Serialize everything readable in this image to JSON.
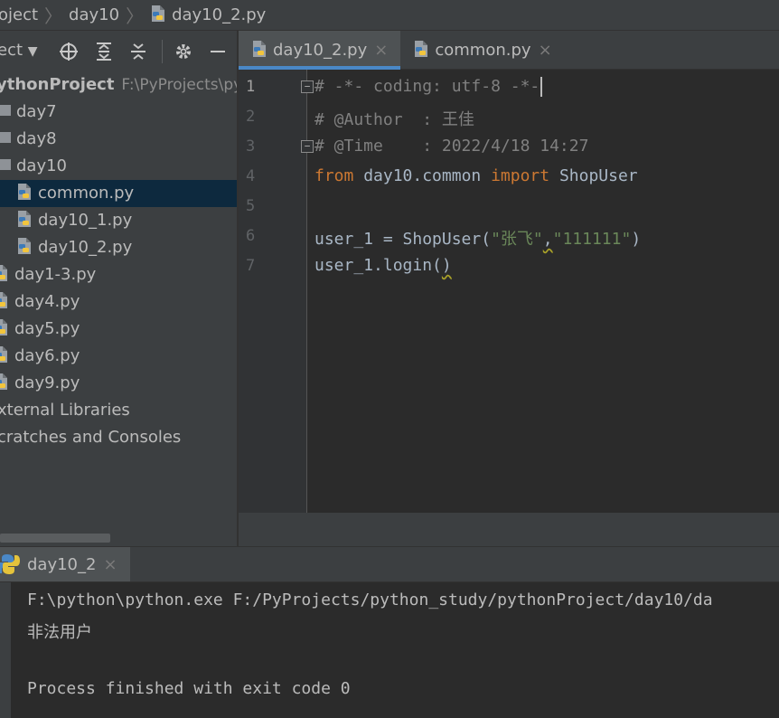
{
  "breadcrumb": {
    "items": [
      {
        "label": "oject",
        "icon": "folder-icon"
      },
      {
        "label": "day10",
        "icon": "folder-icon"
      },
      {
        "label": "day10_2.py",
        "icon": "python-file-icon"
      }
    ]
  },
  "project_panel": {
    "title": "ect",
    "toolbar_icons": [
      "dropdown-icon",
      "crosshair-icon",
      "expand-all-icon",
      "collapse-all-icon",
      "gear-icon",
      "minimize-icon"
    ],
    "root": {
      "label": "ythonProject",
      "path": "F:\\PyProjects\\py"
    },
    "items": [
      {
        "label": "day7",
        "type": "folder"
      },
      {
        "label": "day8",
        "type": "folder"
      },
      {
        "label": "day10",
        "type": "folder"
      },
      {
        "label": "common.py",
        "type": "python",
        "selected": true
      },
      {
        "label": "day10_1.py",
        "type": "python"
      },
      {
        "label": "day10_2.py",
        "type": "python"
      },
      {
        "label": "day1-3.py",
        "type": "python"
      },
      {
        "label": "day4.py",
        "type": "python"
      },
      {
        "label": "day5.py",
        "type": "python"
      },
      {
        "label": "day6.py",
        "type": "python"
      },
      {
        "label": "day9.py",
        "type": "python"
      },
      {
        "label": "xternal Libraries",
        "type": "other"
      },
      {
        "label": "cratches and Consoles",
        "type": "other"
      }
    ]
  },
  "editor_tabs": [
    {
      "label": "day10_2.py",
      "active": true,
      "close": "×"
    },
    {
      "label": "common.py",
      "active": false,
      "close": "×"
    }
  ],
  "editor": {
    "line_numbers": [
      "1",
      "2",
      "3",
      "4",
      "5",
      "6",
      "7"
    ],
    "lines": {
      "l1": "# -*- coding: utf-8 -*-",
      "l2": "# @Author  : 王佳",
      "l3": "# @Time    : 2022/4/18 14:27",
      "l4": {
        "kw1": "from",
        "mod": " day10.common ",
        "kw2": "import",
        "name": " ShopUser"
      },
      "l6": {
        "pre": "user_1 = ShopUser(",
        "s1": "\"张飞\"",
        "comma": ",",
        "s2": "\"111111\"",
        "post": ")"
      },
      "l7": {
        "pre": "user_1.login(",
        "post": ")"
      }
    }
  },
  "run_panel": {
    "tab_label": "day10_2",
    "tab_close": "×",
    "console_lines": [
      "F:\\python\\python.exe F:/PyProjects/python_study/pythonProject/day10/da",
      "非法用户",
      "",
      "Process finished with exit code 0"
    ]
  },
  "colors": {
    "background": "#2b2b2b",
    "panel": "#3c3f41",
    "selection": "#0d293e",
    "accent": "#4a88c7",
    "keyword": "#cc7832",
    "string": "#6a8759",
    "comment": "#808080"
  }
}
